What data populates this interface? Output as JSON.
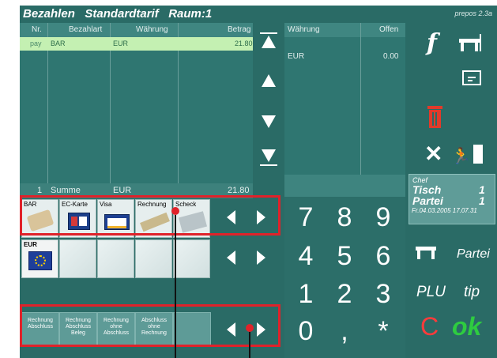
{
  "window": {
    "title": "Bezahlen   Standardtarif   Raum:1",
    "version": "prepos 2.3a"
  },
  "payment_table": {
    "headers": [
      "Nr.",
      "Bezahlart",
      "Währung",
      "Betrag"
    ],
    "rows": [
      {
        "nr": "pay",
        "bezahlart": "BAR",
        "waehrung": "EUR",
        "betrag": "21.80"
      }
    ],
    "summary": {
      "nr": "1",
      "label": "Summe",
      "waehrung": "EUR",
      "betrag": "21.80"
    }
  },
  "open_table": {
    "headers": [
      "Währung",
      "Offen"
    ],
    "rows": [
      {
        "waehrung": "EUR",
        "offen": "0.00"
      }
    ]
  },
  "payment_types": [
    {
      "label": "BAR"
    },
    {
      "label": "EC-Karte"
    },
    {
      "label": "Visa"
    },
    {
      "label": "Rechnung"
    },
    {
      "label": "Scheck"
    }
  ],
  "currency_tiles": [
    {
      "label": "EUR"
    }
  ],
  "print_options": [
    {
      "label": "Rechnung Abschluss"
    },
    {
      "label": "Rechnung Abschluss Beleg"
    },
    {
      "label": "Rechnung ohne Abschluss"
    },
    {
      "label": "Abschluss ohne Rechnung"
    }
  ],
  "keypad": {
    "keys": [
      "7",
      "8",
      "9",
      "4",
      "5",
      "6",
      "1",
      "2",
      "3",
      "0",
      ",",
      "*"
    ]
  },
  "side": {
    "f_label": "f",
    "partei_label": "Partei",
    "plu_label": "PLU",
    "tip_label": "tip",
    "clear_label": "C",
    "ok_label": "ok",
    "icons": [
      "table-icon",
      "print-receipt-icon",
      "trash-icon",
      "close-icon",
      "exit-icon"
    ]
  },
  "info_box": {
    "role": "Chef",
    "tisch_label": "Tisch",
    "tisch_value": "1",
    "partei_label": "Partei",
    "partei_value": "1",
    "datetime": "Fr.04.03.2005 17.07.31"
  },
  "colors": {
    "background": "#2a6b66",
    "selected_row": "#c4f0b2",
    "highlight": "#e0222a",
    "ok": "#2ecc40",
    "clear": "#ff3b3b"
  }
}
